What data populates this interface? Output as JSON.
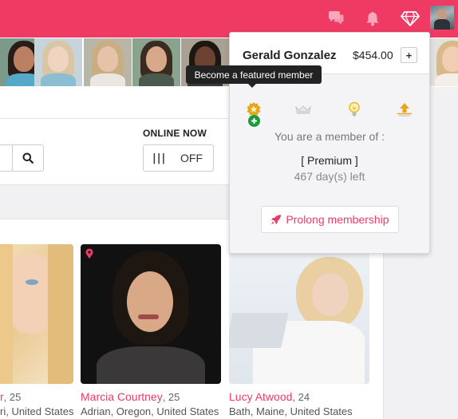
{
  "colors": {
    "brand": "#ef3a64",
    "gold": "#e8a61f",
    "success": "#1a9a3a"
  },
  "header": {
    "icons": [
      "chat-icon",
      "bell-icon",
      "diamond-icon",
      "avatar"
    ]
  },
  "membership_popup": {
    "user_name": "Gerald Gonzalez",
    "balance": "$454.00",
    "add_label": "+",
    "tooltip": "Become a featured member",
    "tiers": [
      "featured-star-icon",
      "bronze-crown-icon",
      "lightbulb-icon",
      "boost-up-icon"
    ],
    "member_of_label": "You are a member of :",
    "plan": "[ Premium ]",
    "days_left": "467 day(s) left",
    "prolong_label": "Prolong membership"
  },
  "filters": {
    "online_now_label": "ONLINE NOW",
    "toggle_state": "OFF"
  },
  "profiles": [
    {
      "name": "r",
      "age": ", 25",
      "location": "ri, United States"
    },
    {
      "name": "Marcia Courtney",
      "age": ", 25",
      "location": "Adrian, Oregon, United States"
    },
    {
      "name": "Lucy Atwood",
      "age": ", 24",
      "location": "Bath, Maine, United States"
    }
  ]
}
